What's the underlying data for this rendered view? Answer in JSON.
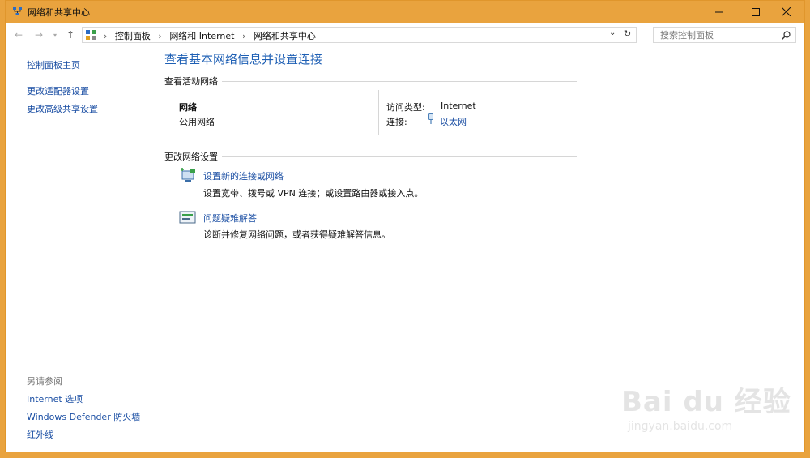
{
  "window": {
    "title": "网络和共享中心"
  },
  "navbar": {
    "breadcrumbs": [
      "控制面板",
      "网络和 Internet",
      "网络和共享中心"
    ],
    "search_placeholder": "搜索控制面板"
  },
  "sidebar": {
    "items": [
      {
        "label": "控制面板主页"
      },
      {
        "label": "更改适配器设置"
      },
      {
        "label": "更改高级共享设置"
      }
    ],
    "see_also_label": "另请参阅",
    "see_also": [
      {
        "label": "Internet 选项"
      },
      {
        "label": "Windows Defender 防火墙"
      },
      {
        "label": "红外线"
      }
    ]
  },
  "main": {
    "title": "查看基本网络信息并设置连接",
    "active_section": "查看活动网络",
    "network_name": "网络",
    "network_type": "公用网络",
    "access_type_label": "访问类型:",
    "access_type_value": "Internet",
    "connection_label": "连接:",
    "connection_value": "以太网",
    "change_section": "更改网络设置",
    "tasks": [
      {
        "title": "设置新的连接或网络",
        "desc": "设置宽带、拨号或 VPN 连接；或设置路由器或接入点。"
      },
      {
        "title": "问题疑难解答",
        "desc": "诊断并修复网络问题，或者获得疑难解答信息。"
      }
    ]
  },
  "watermark": {
    "text": "Bai du 经验",
    "sub": "jingyan.baidu.com"
  },
  "colors": {
    "titlebar": "#e9a33e",
    "link": "#1a4ea3",
    "heading": "#1e5fb4"
  }
}
